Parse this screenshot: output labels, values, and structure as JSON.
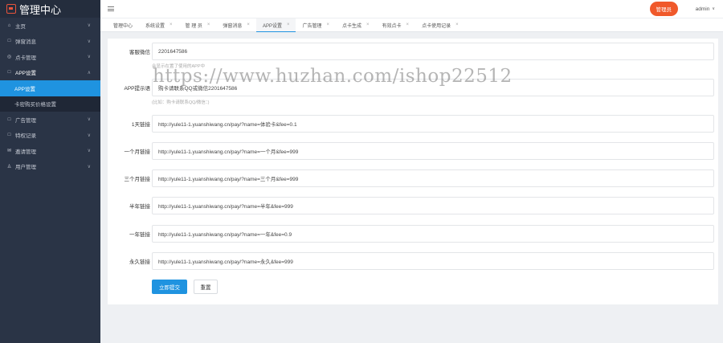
{
  "app": {
    "title": "管理中心"
  },
  "sidebar": {
    "items": [
      {
        "icon": "home-icon",
        "glyph": "⌂",
        "label": "主页"
      },
      {
        "icon": "message-icon",
        "glyph": "□",
        "label": "弹窗消息"
      },
      {
        "icon": "card-icon",
        "glyph": "◎",
        "label": "点卡管理"
      },
      {
        "icon": "app-icon",
        "glyph": "□",
        "label": "APP设置",
        "open": true,
        "children": [
          {
            "label": "APP设置",
            "active": true
          },
          {
            "label": "卡密购买价格设置"
          }
        ]
      },
      {
        "icon": "ad-icon",
        "glyph": "□",
        "label": "广告管理"
      },
      {
        "icon": "vip-icon",
        "glyph": "□",
        "label": "特权记录"
      },
      {
        "icon": "mail-icon",
        "glyph": "✉",
        "label": "邀请管理"
      },
      {
        "icon": "user-icon",
        "glyph": "♙",
        "label": "用户管理"
      }
    ]
  },
  "topbar": {
    "admin_button": "管理员",
    "user": "admin"
  },
  "tabs": [
    {
      "label": "管理中心"
    },
    {
      "label": "系统设置"
    },
    {
      "label": "管 理 员"
    },
    {
      "label": "弹窗消息"
    },
    {
      "label": "APP设置",
      "active": true
    },
    {
      "label": "广告管理"
    },
    {
      "label": "点卡生成"
    },
    {
      "label": "有效点卡"
    },
    {
      "label": "点卡使用记录"
    }
  ],
  "form": {
    "fields": [
      {
        "label": "客服微信",
        "value": "2201647586",
        "hint": "会显示在置了使用的APP中"
      },
      {
        "label": "APP提示语",
        "value": "购卡请联系QQ或微信2201647586",
        "hint": "(比如：购卡请联系QQ/微信：)"
      },
      {
        "label": "1天链接",
        "value": "http://yule11-1.yuanshiwang.cn/pay/?name=体验卡&fee=0.1"
      },
      {
        "label": "一个月链接",
        "value": "http://yule11-1.yuanshiwang.cn/pay/?name=一个月&fee=999"
      },
      {
        "label": "三个月链接",
        "value": "http://yule11-1.yuanshiwang.cn/pay/?name=三个月&fee=999"
      },
      {
        "label": "半年链接",
        "value": "http://yule11-1.yuanshiwang.cn/pay/?name=半年&fee=999"
      },
      {
        "label": "一年链接",
        "value": "http://yule11-1.yuanshiwang.cn/pay/?name=一年&fee=0.9"
      },
      {
        "label": "永久链接",
        "value": "http://yule11-1.yuanshiwang.cn/pay/?name=永久&fee=999"
      }
    ],
    "submit": "立即提交",
    "reset": "重置"
  },
  "watermark": "https://www.huzhan.com/ishop22512",
  "colors": {
    "sidebar": "#2a3446",
    "accent": "#1f93e0",
    "admin": "#f0592b"
  }
}
